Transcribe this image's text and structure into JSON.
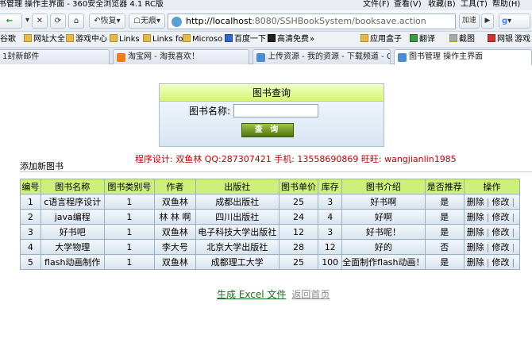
{
  "window": {
    "title": "书管理 操作主界面 - 360安全浏览器 4.1 RC版",
    "menus": [
      "文件(F)",
      "查看(V)",
      "收藏(B)",
      "工具(T)",
      "帮助(H)"
    ]
  },
  "nav": {
    "back": "←",
    "forward": "→",
    "stop": "✕",
    "refresh": "⟳",
    "home": "⌂",
    "restore": "恢复",
    "traceless": "无痕",
    "url_host": "http://localhost",
    "url_path": ":8080/SSHBookSystem/booksave.action",
    "accelerate": "加速",
    "go": "▶"
  },
  "bookmarks": [
    "谷歌",
    "网址大全",
    "游戏中心",
    "Links",
    "Links fo",
    "Microso",
    "百度一下",
    "高清免费",
    "应用盒子",
    "翻译",
    "截图",
    "网银",
    "游戏"
  ],
  "tabs": [
    {
      "label": "1封新邮件",
      "icon_color": "#d84f3a"
    },
    {
      "label": "淘宝网 - 淘我喜欢！",
      "icon_color": "#f07b1c"
    },
    {
      "label": "上传资源 - 我的资源 - 下载频道 - C...",
      "icon_color": "#4c8bd6"
    },
    {
      "label": "图书管理 操作主界面",
      "icon_color": "#4c8bd6"
    }
  ],
  "search": {
    "title": "图书查询",
    "label": "图书名称:",
    "value": "",
    "button": "查 询"
  },
  "credits": "程序设计: 双鱼林   QQ:287307421    手机: 13558690869  旺旺: wangjianlin1985",
  "add_link": "添加新图书",
  "table": {
    "headers": [
      "编号",
      "图书名称",
      "图书类别号",
      "作者",
      "出版社",
      "图书单价",
      "库存",
      "图书介绍",
      "是否推荐",
      "操作"
    ],
    "rows": [
      [
        "1",
        "c语言程序设计",
        "1",
        "双鱼林",
        "成都出版社",
        "25",
        "3",
        "好书啊",
        "是"
      ],
      [
        "2",
        "java编程",
        "1",
        "林  林  啊",
        "四川出版社",
        "24",
        "4",
        "好啊",
        "是"
      ],
      [
        "3",
        "好书吧",
        "1",
        "双鱼林",
        "电子科技大学出版社",
        "12",
        "3",
        "好书呢！",
        "是"
      ],
      [
        "4",
        "大学物理",
        "1",
        "李大号",
        "北京大学出版社",
        "28",
        "12",
        "好的",
        "否"
      ],
      [
        "5",
        "flash动画制作",
        "1",
        "双鱼林",
        "成都理工大学",
        "25",
        "100",
        "全面制作flash动画！",
        "是"
      ]
    ],
    "delete_label": "删除",
    "edit_label": "修改",
    "separator": "|"
  },
  "footer": {
    "excel": "生成  Excel 文件",
    "home": "返回首页"
  }
}
